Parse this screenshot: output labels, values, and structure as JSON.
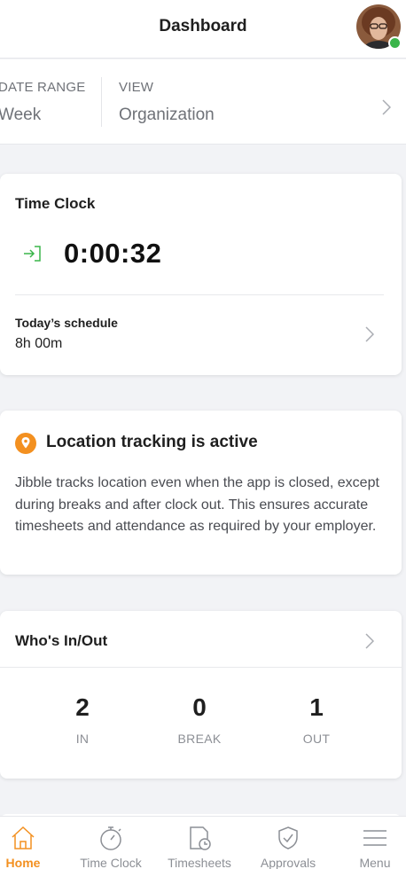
{
  "header": {
    "title": "Dashboard"
  },
  "filters": {
    "date_range_label": "DATE RANGE",
    "date_range_value": "Week",
    "view_label": "VIEW",
    "view_value": "Organization"
  },
  "time_clock": {
    "title": "Time Clock",
    "elapsed": "0:00:32",
    "schedule_label": "Today’s schedule",
    "schedule_value": "8h 00m"
  },
  "location": {
    "title": "Location tracking is active",
    "body": "Jibble tracks location even when the app is closed, except during breaks and after clock out. This ensures accurate timesheets and attendance as required by your employer."
  },
  "whos_in_out": {
    "title": "Who's In/Out",
    "stats": [
      {
        "value": "2",
        "label": "IN"
      },
      {
        "value": "0",
        "label": "BREAK"
      },
      {
        "value": "1",
        "label": "OUT"
      }
    ]
  },
  "nav": {
    "items": [
      {
        "label": "Home",
        "icon": "home-icon",
        "active": true
      },
      {
        "label": "Time Clock",
        "icon": "stopwatch-icon",
        "active": false
      },
      {
        "label": "Timesheets",
        "icon": "timesheet-icon",
        "active": false
      },
      {
        "label": "Approvals",
        "icon": "shield-check-icon",
        "active": false
      },
      {
        "label": "Menu",
        "icon": "hamburger-menu-icon",
        "active": false
      }
    ]
  },
  "colors": {
    "accent": "#f39020",
    "clock_in_green": "#3ab54a",
    "online_status": "#3ab54a",
    "location_orange": "#f39020"
  }
}
